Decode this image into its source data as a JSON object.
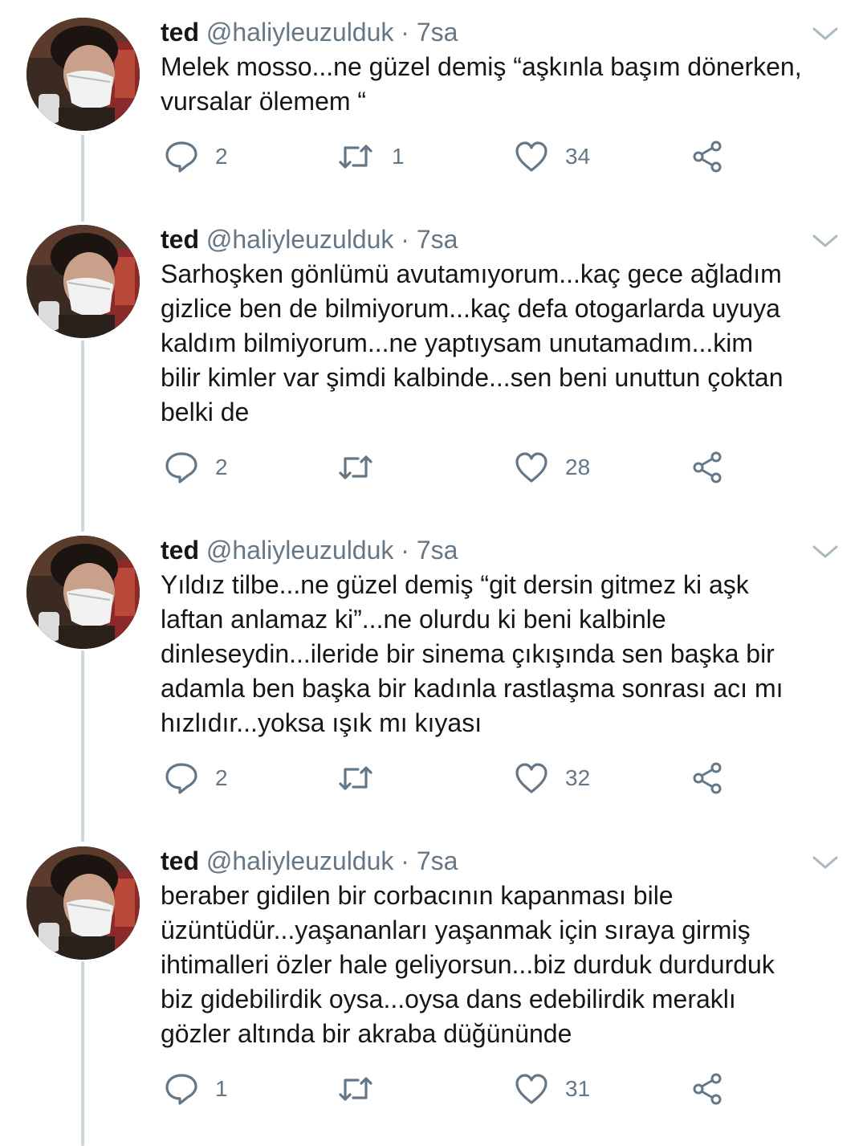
{
  "tweets": [
    {
      "name": "ted",
      "handle": "@haliyleuzulduk",
      "separator": "·",
      "time": "7sa",
      "text": "Melek mosso...ne güzel demiş “aşkınla başım dönerken,\nvursalar ölemem “",
      "replies": "2",
      "retweets": "1",
      "likes": "34"
    },
    {
      "name": "ted",
      "handle": "@haliyleuzulduk",
      "separator": "·",
      "time": "7sa",
      "text": "Sarhoşken gönlümü avutamıyorum...kaç gece ağladım\ngizlice ben de bilmiyorum...kaç defa otogarlarda uyuya\nkaldım bilmiyorum...ne yaptıysam unutamadım...kim\nbilir kimler var şimdi kalbinde...sen beni unuttun çoktan\nbelki de",
      "replies": "2",
      "retweets": "",
      "likes": "28"
    },
    {
      "name": "ted",
      "handle": "@haliyleuzulduk",
      "separator": "·",
      "time": "7sa",
      "text": "Yıldız tilbe...ne güzel demiş “git dersin gitmez ki aşk\nlaftan anlamaz ki”...ne olurdu ki beni kalbinle\ndinleseydin...ileride bir sinema çıkışında sen başka bir\nadamla ben başka bir kadınla rastlaşma sonrası acı mı\nhızlıdır...yoksa ışık mı kıyası",
      "replies": "2",
      "retweets": "",
      "likes": "32"
    },
    {
      "name": "ted",
      "handle": "@haliyleuzulduk",
      "separator": "·",
      "time": "7sa",
      "text": "beraber gidilen bir corbacının kapanması bile\nüzüntüdür...yaşananları yaşanmak için sıraya girmiş\nihtimalleri özler hale geliyorsun...biz durduk durdurduk\nbiz gidebilirdik oysa...oysa dans edebilirdik meraklı\ngözler altında bir akraba düğününde",
      "replies": "1",
      "retweets": "",
      "likes": "31"
    }
  ],
  "icons": {
    "reply": "reply-icon",
    "retweet": "retweet-icon",
    "like": "heart-icon",
    "share": "share-icon",
    "menu": "chevron-down-icon"
  },
  "colors": {
    "text": "#14171a",
    "secondary": "#657786",
    "thread_line": "#ccd6dd"
  }
}
